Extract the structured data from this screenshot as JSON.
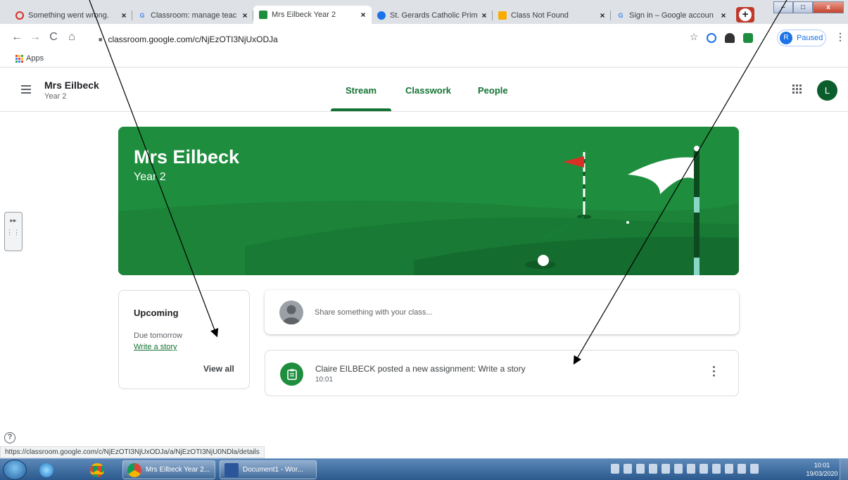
{
  "browser": {
    "tabs": [
      {
        "title": "Something went wrong.",
        "favicon_color": "#d93025"
      },
      {
        "title": "Classroom: manage teac",
        "favicon_color": "#4285f4",
        "favicon_glyph": "G"
      },
      {
        "title": "Mrs Eilbeck Year 2",
        "favicon_color": "#1e8e3e",
        "active": true
      },
      {
        "title": "St. Gerards Catholic Prim",
        "favicon_color": "#1a73e8"
      },
      {
        "title": "Class Not Found",
        "favicon_color": "#f9ab00"
      },
      {
        "title": "Sign in – Google accoun",
        "favicon_color": "#4285f4",
        "favicon_glyph": "G"
      }
    ],
    "tab_close": "×",
    "new_tab": "+",
    "url": "classroom.google.com/c/NjEzOTI3NjUxODJa",
    "profile_initial": "R",
    "profile_status": "Paused",
    "bookmarks_apps": "Apps",
    "status_url": "https://classroom.google.com/c/NjEzOTI3NjUxODJa/a/NjEzOTI3NjU0NDla/details"
  },
  "classroom": {
    "class_name": "Mrs Eilbeck",
    "section": "Year 2",
    "nav_tabs": [
      "Stream",
      "Classwork",
      "People"
    ],
    "user_initial": "L",
    "banner": {
      "title": "Mrs Eilbeck",
      "subtitle": "Year 2"
    },
    "upcoming": {
      "title": "Upcoming",
      "due": "Due tomorrow",
      "item": "Write a story",
      "view_all": "View all"
    },
    "share_placeholder": "Share something with your class...",
    "post": {
      "text": "Claire EILBECK posted a new assignment: Write a story",
      "time": "10:01"
    },
    "accent_color": "#1e8e3e"
  },
  "taskbar": {
    "apps": [
      "Mrs Eilbeck Year 2...",
      "Document1 - Wor..."
    ],
    "time": "10:01",
    "date": "19/03/2020"
  }
}
